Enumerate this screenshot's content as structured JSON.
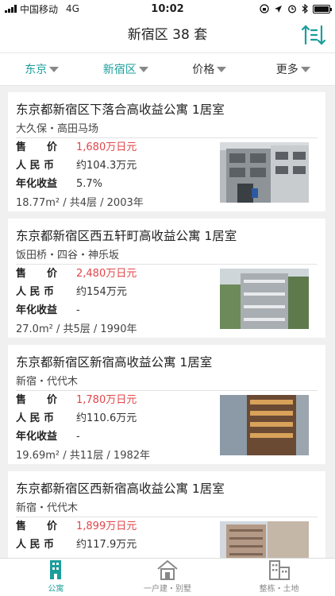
{
  "status_bar": {
    "carrier": "中国移动",
    "network": "4G",
    "time": "10:02"
  },
  "nav": {
    "title": "新宿区 38 套",
    "sort_icon": "sort-icon"
  },
  "filters": [
    {
      "label": "东京",
      "active": true
    },
    {
      "label": "新宿区",
      "active": true
    },
    {
      "label": "价格",
      "active": false
    },
    {
      "label": "更多",
      "active": false
    }
  ],
  "accent_color": "#1a9e9b",
  "price_color": "#e0464a",
  "labels": {
    "price": "售　　价",
    "rmb": "人 民 币",
    "yield": "年化收益"
  },
  "listings": [
    {
      "title": "东京都新宿区下落合高收益公寓 1居室",
      "area": "大久保・高田马场",
      "price": "1,680万日元",
      "rmb": "约104.3万元",
      "yield": "5.7%",
      "meta": "18.77m² / 共4层 / 2003年"
    },
    {
      "title": "东京都新宿区西五轩町高收益公寓 1居室",
      "area": "饭田桥・四谷・神乐坂",
      "price": "2,480万日元",
      "rmb": "约154万元",
      "yield": "-",
      "meta": "27.0m² / 共5层 / 1990年"
    },
    {
      "title": "东京都新宿区新宿高收益公寓 1居室",
      "area": "新宿・代代木",
      "price": "1,780万日元",
      "rmb": "约110.6万元",
      "yield": "-",
      "meta": "19.69m² / 共11层 / 1982年"
    },
    {
      "title": "东京都新宿区西新宿高收益公寓 1居室",
      "area": "新宿・代代木",
      "price": "1,899万日元",
      "rmb": "约117.9万元",
      "yield": "",
      "meta": ""
    }
  ],
  "tabs": [
    {
      "label": "公寓",
      "icon": "apartment-icon",
      "active": true
    },
    {
      "label": "一户建・别墅",
      "icon": "house-icon",
      "active": false
    },
    {
      "label": "整栋・土地",
      "icon": "building-icon",
      "active": false
    }
  ]
}
